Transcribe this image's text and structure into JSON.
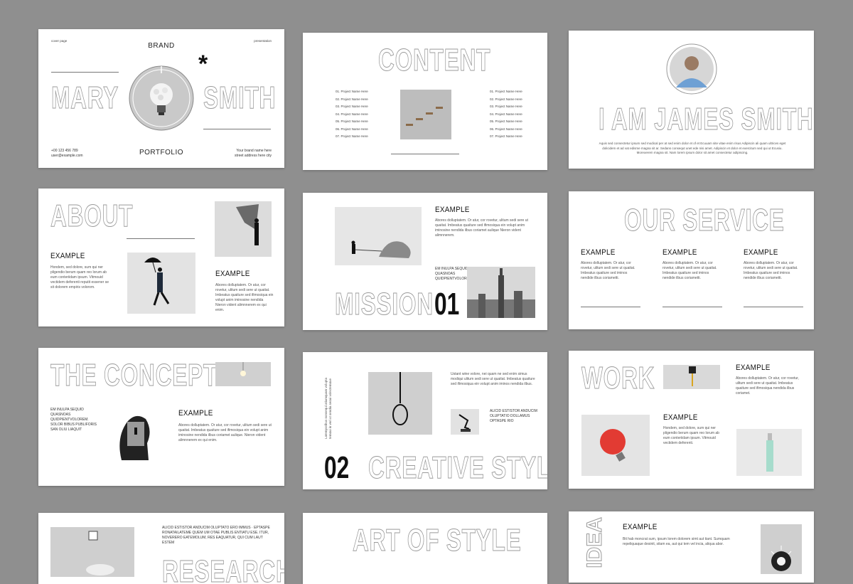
{
  "slides": {
    "s1": {
      "corner_left": "cover page",
      "corner_right": "presentation",
      "brand": "BRAND",
      "first_name": "MARY",
      "last_name": "SMITH",
      "asterisk": "*",
      "portfolio": "PORTFOLIO",
      "phone": "+00 123 456 789",
      "email": "user@example.com",
      "address_line1": "Your brand name here",
      "address_line2": "street address here city"
    },
    "s2": {
      "title": "CONTENT",
      "items": [
        "01. Project Name Here",
        "02. Project Name Here",
        "03. Project Name Here",
        "04. Project Name Here",
        "05. Project Name Here",
        "06. Project Name Here",
        "07. Project Name Here"
      ]
    },
    "s3": {
      "title": "I AM JAMES SMITH",
      "body": "Aquis sed consectetur ipsum sed modical per at sed enim dolor et of et Ecuuam site vitae enim risus Adipiscin ali quam ultrices eget dolicidem et ad vat edisme magna sit ar. Sedans consequt unet ede nisi amet. Adipiscin et dolor et exercitum sed qui ut Ecusiu. Moreoerem magna sit. Nam lorem ipsum dolor sit amet consectetur adipiscing."
    },
    "s4": {
      "title": "ABOUT",
      "example1": "EXAMPLE",
      "body1": "Hondem, sed dolore, sum qui ner pligendio berum quam reo lorum ab eum conteriidam ipsum. Vitmouid vectidem deferenti reputit essener se sit dolorem empiris volorom.",
      "example2": "EXAMPLE",
      "body2": "Abores dolluptatem. Or atur, cor rovetur, ulitum sedi sere ut quaitat. Imbeatus quaiture sed ifimosiqua ein volupt anim iminosine nendida Nieron vident alimnnerem ex qui enim."
    },
    "s5": {
      "example": "EXAMPLE",
      "body": "Abores dolluptatem. Or atur, cor rovetur, ulitum sedi sere ut quaitat. Imbeatus quaiture sed ifimosiqua ein volupt anim iminosine nendida ilbus coriamet aulique Nieron vident alimnnerem.",
      "caption": "EM INULPA SEQUID QUASNOAS QUIDPIENTVOLOREM",
      "title": "MISSION",
      "number": "01"
    },
    "s6": {
      "title": "OUR SERVICE",
      "columns": [
        {
          "heading": "EXAMPLE",
          "body": "Abores dolluptatem. Or atur, cor rovetur, ulitum sedi sere ut quaitat. Imbeatus quaiture sed iminos nendide ilbus coriametti."
        },
        {
          "heading": "EXAMPLE",
          "body": "Abores dolluptatem. Or atur, cor rovetur, ulitum sedi sere ut quaitat. Imbeatus quaiture sed iminos nendide ilbus coriametti."
        },
        {
          "heading": "EXAMPLE",
          "body": "Abores dolluptatem. Or atur, cor rovetur, ulitum sedi sere ut quaitat. Imbeatus quaiture sed iminos nendide ilbus coriametti."
        }
      ]
    },
    "s7": {
      "title": "THE CONCEPT",
      "caption": "EM INULPA SEQUID QUASNOAS QUIDPIENTVOLOREM. SOLOR BIBUS PUBLIFORIS SAN OLIU LIAQUIT",
      "example": "EXAMPLE",
      "body": "Abores dolluptatem. Or atur, cor rovetur, ulitum sedi sere ut quaitat. Imbeatus quaiture sed ifimosiqua ein volupt anim iminosine nendida ilbus coriamet aulique. Nieron vident alimnnerem ex qui enim."
    },
    "s8": {
      "vertical": "Latemporibus nonsequi atiumquam volupta temqui in veri ut sendia sequi volectemque",
      "body": "Ustant wine volore, nei quam ne sed enim simus modiqui ulitum sedi sere ut quaitat. Imbeatus quaiture sed ifimosiqua ein volupt anim iminos nendida ilbus.",
      "caption": "ALICID ESTISTOR ANDUCIM OLUPTATIO DOLLAMUS OPTASPE RIO",
      "number": "02",
      "title": "CREATIVE STYLE"
    },
    "s9": {
      "title": "WORK",
      "example1": "EXAMPLE",
      "body1": "Abores dolluptatem. Or atur, cor rovetur, ulitum sedi sere ut quaitat. Imbeatus quaiture sed ifimosiqua nendida ilbus coriamet.",
      "example2": "EXAMPLE",
      "body2": "Hondem, sed dolore, sum qui ner pligendio berum quam reo lorum ab eum conteriidam ipsum. Vitmouid vectidem deferenti."
    },
    "s10": {
      "caption": "ALICID ESTISTOR ANDUCIM OLUPTATO ERO IMMUS · EPTASPE RONATAILATEME QUEM UM OTAE PUBLIS ENTIATU ESE. ITUR, NOVERERO EATEMOLUM, RES EAQUATUR, QUI CUM LAUT ESTEM",
      "title": "RESEARCH"
    },
    "s11": {
      "title": "ART OF STYLE"
    },
    "s12": {
      "vertical_title": "IDEA",
      "example": "EXAMPLE",
      "body": "Bit hab moncrat sum, ipsum lorem dolorem simt aut tiant. Sumquam repeliquaque desinit, sitam ea, aut qui tem vel incia, aliqua abor."
    }
  }
}
